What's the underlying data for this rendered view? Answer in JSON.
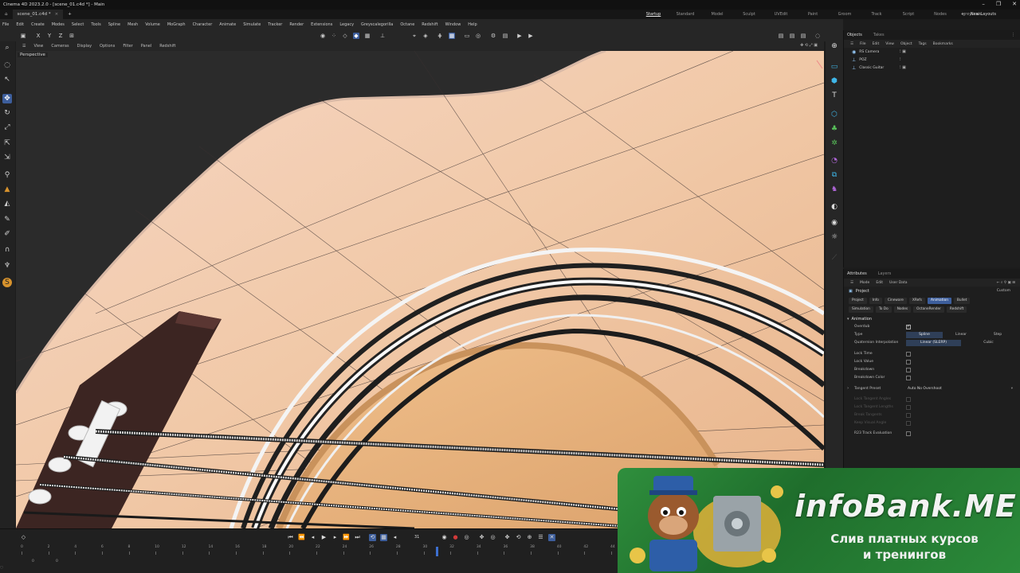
{
  "window": {
    "title": "Cinema 4D 2023.2.0 - [scene_01.c4d *] - Main",
    "controls": [
      "–",
      "❐",
      "✕"
    ]
  },
  "tabs": {
    "document": "scene_01.c4d *",
    "add": "+",
    "layouts": [
      "Startup",
      "Standard",
      "Model",
      "Sculpt",
      "UVEdit",
      "Paint",
      "Groom",
      "Track",
      "Script",
      "Nodes",
      "greyscale"
    ],
    "active_layout": "Startup",
    "new_layouts": "New Layouts"
  },
  "menu": [
    "File",
    "Edit",
    "Create",
    "Modes",
    "Select",
    "Tools",
    "Spline",
    "Mesh",
    "Volume",
    "MoGraph",
    "Character",
    "Animate",
    "Simulate",
    "Tracker",
    "Render",
    "Extensions",
    "Legacy",
    "Greyscalegorilla",
    "Octane",
    "Redshift",
    "Window",
    "Help"
  ],
  "viewport": {
    "menu": [
      "View",
      "Cameras",
      "Display",
      "Options",
      "Filter",
      "Panel",
      "Redshift"
    ],
    "label": "Perspective"
  },
  "object_manager": {
    "tabs": [
      "Objects",
      "Takes"
    ],
    "active_tab": "Objects",
    "menu": [
      "File",
      "Edit",
      "View",
      "Object",
      "Tags",
      "Bookmarks"
    ],
    "objects": [
      {
        "name": "RS Camera",
        "icon": "camera-icon"
      },
      {
        "name": "POZ",
        "icon": "null-icon"
      },
      {
        "name": "Classic Guitar",
        "icon": "null-icon"
      }
    ]
  },
  "attributes": {
    "tabs": [
      "Attributes",
      "Layers"
    ],
    "active_tab": "Attributes",
    "menu": [
      "Mode",
      "Edit",
      "User Data"
    ],
    "preset": "Custom",
    "title": "Project",
    "chips_row1": [
      "Project",
      "Info",
      "Cineware",
      "XRefs",
      "Animation",
      "Bullet"
    ],
    "chips_row2": [
      "Simulation",
      "To Do",
      "Nodes",
      "OctaneRender",
      "Redshift"
    ],
    "active_chip": "Animation",
    "section": "Animation",
    "rows": {
      "overdub": "Overdub",
      "type": "Type",
      "type_options": [
        "Spline",
        "Linear",
        "Step"
      ],
      "type_selected": "Spline",
      "quat": "Quaternion Interpolation",
      "quat_options": [
        "Linear (SLERP)",
        "Cubic"
      ],
      "quat_selected": "Linear (SLERP)",
      "lock_time": "Lock Time",
      "lock_value": "Lock Value",
      "breakdown": "Breakdown",
      "breakdown_color": "Breakdown Color",
      "tangent_preset": "Tangent Preset",
      "tangent_value": "Auto No Overshoot",
      "lock_tangent_angles": "Lock Tangent Angles",
      "lock_tangent_lengths": "Lock Tangent Lengths",
      "break_tangents": "Break Tangents",
      "keep_visual_angle": "Keep Visual Angle",
      "r23": "R23 Track Evaluation"
    }
  },
  "timeline": {
    "current_frame": "31",
    "ticks": [
      "0",
      "2",
      "4",
      "6",
      "8",
      "10",
      "12",
      "14",
      "16",
      "18",
      "20",
      "22",
      "24",
      "26",
      "28",
      "30",
      "32",
      "34",
      "36",
      "38",
      "40",
      "42",
      "44"
    ],
    "playhead_frame": 31,
    "max_frame": 44,
    "bottom_left": "0",
    "bottom_right": "0"
  },
  "watermark": {
    "title": "infoBank.ME",
    "line1": "Слив платных курсов",
    "line2": "и тренингов"
  },
  "colors": {
    "accent": "#3d5e9c",
    "wood": "#f0c9a6",
    "soundhole": "#e8b47c",
    "banner_green": "#2b8a3a"
  }
}
